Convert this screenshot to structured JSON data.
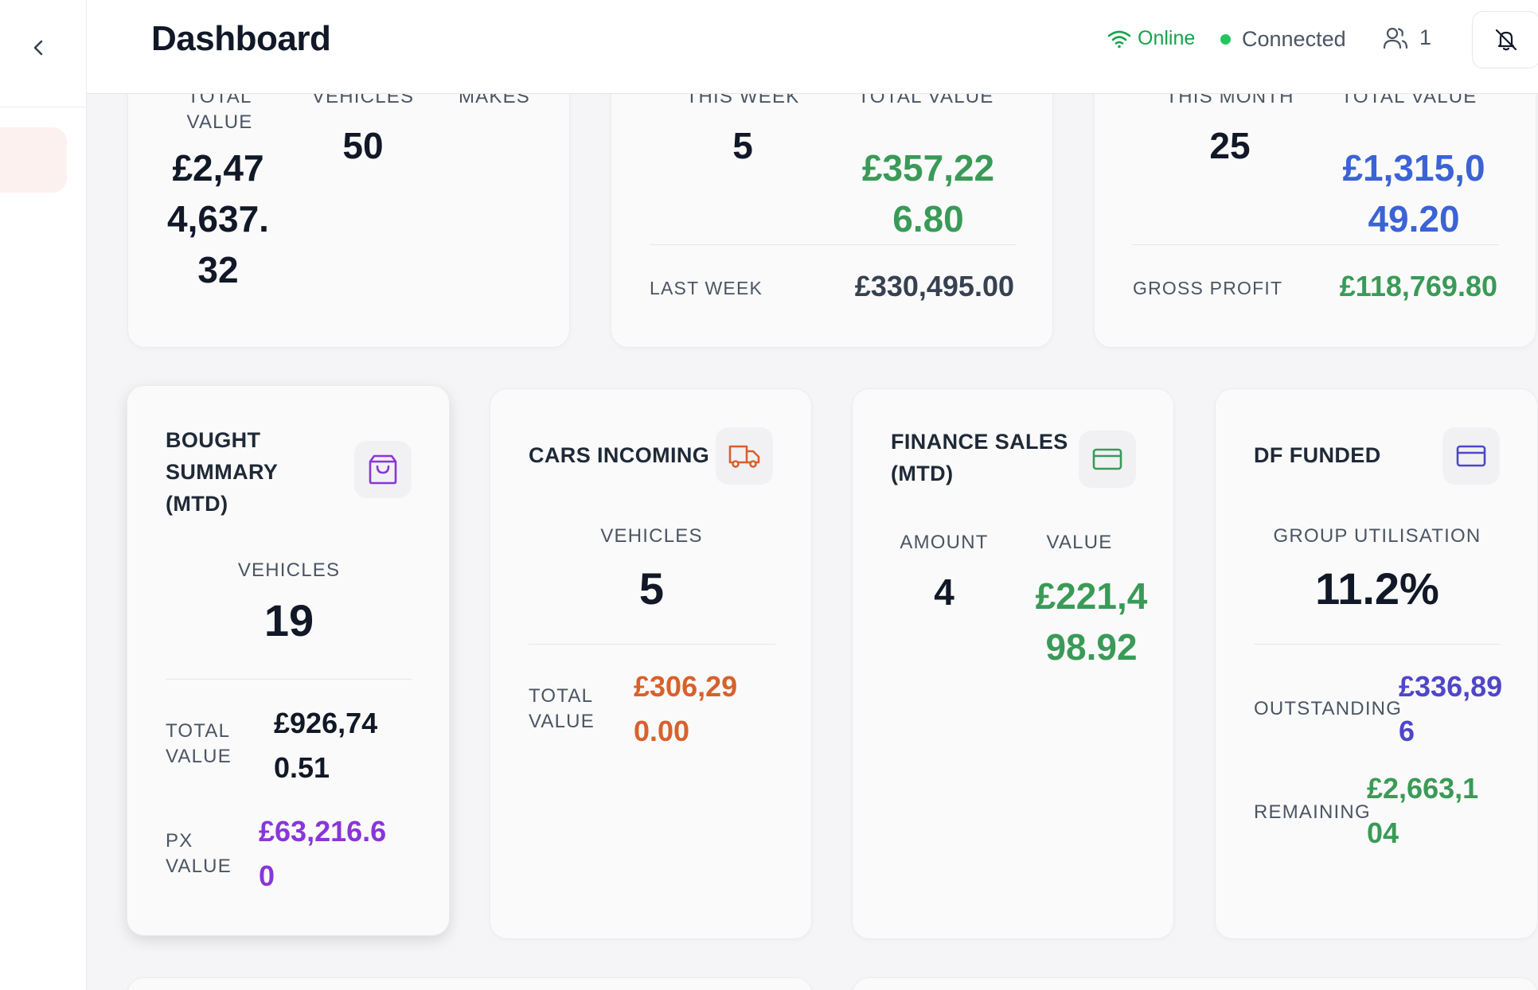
{
  "header": {
    "title": "Dashboard",
    "online_label": "Online",
    "connected_label": "Connected",
    "users_count": "1"
  },
  "top_row": {
    "card1": {
      "col1_label": "TOTAL VALUE",
      "col1_value": "£2,474,637.32",
      "col2_label": "VEHICLES",
      "col2_value": "50",
      "col3_label": "MAKES"
    },
    "card2": {
      "col1_label": "THIS WEEK",
      "col1_value": "5",
      "col2_label": "TOTAL VALUE",
      "col2_value": "£357,226.80",
      "footer_label": "LAST WEEK",
      "footer_value": "£330,495.00"
    },
    "card3": {
      "col1_label": "THIS MONTH",
      "col1_value": "25",
      "col2_label": "TOTAL VALUE",
      "col2_value": "£1,315,049.20",
      "footer_label": "GROSS PROFIT",
      "footer_value": "£118,769.80"
    }
  },
  "bought_summary": {
    "title": "BOUGHT SUMMARY (MTD)",
    "icon": "shopping-bag-icon",
    "vehicles_label": "VEHICLES",
    "vehicles_value": "19",
    "total_value_label": "TOTAL VALUE",
    "total_value": "£926,740.51",
    "px_value_label": "PX VALUE",
    "px_value": "£63,216.60"
  },
  "cars_incoming": {
    "title": "CARS INCOMING",
    "icon": "truck-icon",
    "vehicles_label": "VEHICLES",
    "vehicles_value": "5",
    "total_value_label": "TOTAL VALUE",
    "total_value": "£306,290.00"
  },
  "finance_sales": {
    "title": "FINANCE SALES (MTD)",
    "icon": "credit-card-icon",
    "amount_label": "AMOUNT",
    "amount_value": "4",
    "value_label": "VALUE",
    "value": "£221,498.92"
  },
  "df_funded": {
    "title": "DF FUNDED",
    "icon": "credit-card-icon",
    "utilisation_label": "GROUP UTILISATION",
    "utilisation_value": "11.2%",
    "outstanding_label": "OUTSTANDING",
    "outstanding_value": "£336,896",
    "remaining_label": "REMAINING",
    "remaining_value": "£2,663,104"
  },
  "colors": {
    "green": "#3a9a57",
    "blue": "#3b63d6",
    "orange": "#d9602b",
    "purple": "#8a35d9",
    "indigo": "#4f46c8",
    "online": "#16a34a"
  }
}
